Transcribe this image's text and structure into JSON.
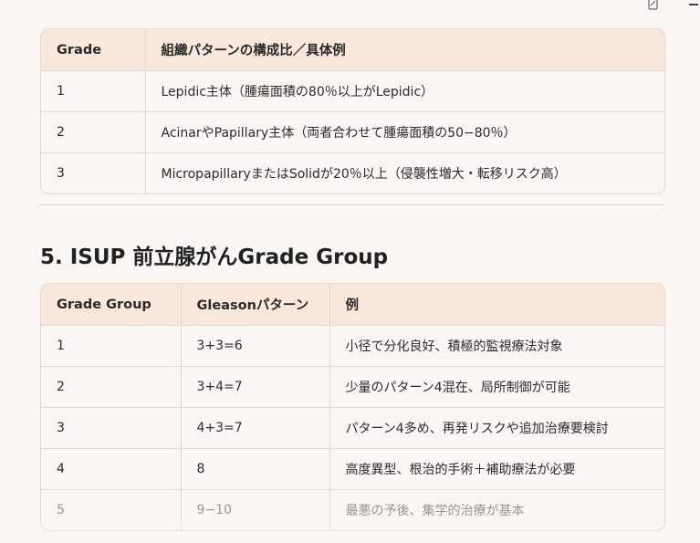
{
  "table1": {
    "headers": [
      "Grade",
      "組織パターンの構成比／具体例"
    ],
    "rows": [
      [
        "1",
        "Lepidic主体（腫瘍面積の80％以上がLepidic）"
      ],
      [
        "2",
        "AcinarやPapillary主体（両者合わせて腫瘍面積の50−80％）"
      ],
      [
        "3",
        "MicropapillaryまたはSolidが20％以上（侵襲性増大・転移リスク高）"
      ]
    ]
  },
  "section": {
    "title": "5. ISUP 前立腺がんGrade Group"
  },
  "table2": {
    "headers": [
      "Grade Group",
      "Gleasonパターン",
      "例"
    ],
    "rows": [
      [
        "1",
        "3+3=6",
        "小径で分化良好、積極的監視療法対象"
      ],
      [
        "2",
        "3+4=7",
        "少量のパターン4混在、局所制御が可能"
      ],
      [
        "3",
        "4+3=7",
        "パターン4多め、再発リスクや追加治療要検討"
      ],
      [
        "4",
        "8",
        "高度異型、根治的手術＋補助療法が必要"
      ],
      [
        "5",
        "9−10",
        "最悪の予後、集学的治療が基本"
      ]
    ]
  },
  "icons": {
    "copy": "copy-icon"
  },
  "colors": {
    "header_bg": "#f8e8dc",
    "border": "#e2d9d1",
    "page_bg": "#f9f6f3"
  }
}
